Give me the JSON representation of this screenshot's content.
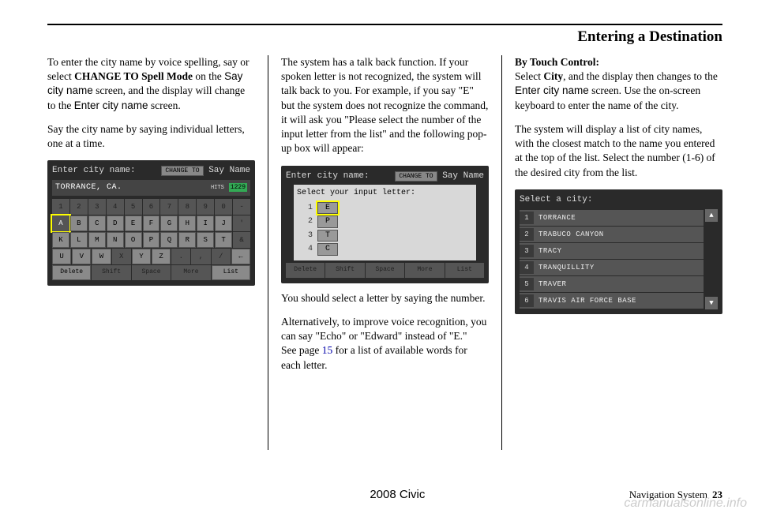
{
  "header": {
    "title": "Entering a Destination"
  },
  "col1": {
    "p1a": "To enter the city name by voice spelling, say or select ",
    "p1b": "CHANGE TO Spell Mode",
    "p1c": " on the ",
    "p1d": "Say city name",
    "p1e": " screen, and the display will change to the ",
    "p1f": "Enter city name",
    "p1g": " screen.",
    "p2": "Say the city name by saying individual letters, one at a time.",
    "ss": {
      "title": "Enter city name:",
      "change_btn": "CHANGE TO",
      "say": "Say Name",
      "input": "TORRANCE, CA.",
      "hits_label": "HITS",
      "hits": "1229",
      "row_nums": [
        "1",
        "2",
        "3",
        "4",
        "5",
        "6",
        "7",
        "8",
        "9",
        "0",
        "-"
      ],
      "row_a": [
        "A",
        "B",
        "C",
        "D",
        "E",
        "F",
        "G",
        "H",
        "I",
        "J",
        "'"
      ],
      "row_k": [
        "K",
        "L",
        "M",
        "N",
        "O",
        "P",
        "Q",
        "R",
        "S",
        "T",
        "&"
      ],
      "row_u": [
        "U",
        "V",
        "W",
        "X",
        "Y",
        "Z",
        ".",
        ",",
        "/",
        "←"
      ],
      "bottom": [
        "Delete",
        "Shift",
        "Space",
        "More",
        "List"
      ]
    }
  },
  "col2": {
    "p1": "The system has a talk back function. If your spoken letter is not recognized, the system will talk back to you. For example, if you say \"E\" but the system does not recognize the command, it will ask you \"Please select the number of the input letter from the list\" and the following pop-up box will appear:",
    "ss": {
      "title_bg": "Enter city name:",
      "change_btn": "CHANGE TO",
      "say": "Say Name",
      "popup_title": "Select your input letter:",
      "options": [
        {
          "n": "1",
          "v": "E"
        },
        {
          "n": "2",
          "v": "P"
        },
        {
          "n": "3",
          "v": "T"
        },
        {
          "n": "4",
          "v": "C"
        }
      ],
      "bottom": [
        "Delete",
        "Shift",
        "Space",
        "More",
        "List"
      ]
    },
    "p2": "You should select a letter by saying the number.",
    "p3a": "Alternatively, to improve voice recognition, you can say \"Echo\" or \"Edward\" instead of \"E.\"",
    "p3b": "See page ",
    "p3_link": "15",
    "p3c": " for a list of available words for each letter."
  },
  "col3": {
    "h": "By Touch Control:",
    "p1a": "Select ",
    "p1b": "City",
    "p1c": ", and the display then changes to the ",
    "p1d": "Enter city name",
    "p1e": " screen. Use the on-screen keyboard to enter the name of the city.",
    "p2": "The system will display a list of city names, with the closest match to the name you entered at the top of the list. Select the number (1-6) of the desired city from the list.",
    "ss": {
      "title": "Select a city:",
      "items": [
        {
          "n": "1",
          "v": "TORRANCE"
        },
        {
          "n": "2",
          "v": "TRABUCO CANYON"
        },
        {
          "n": "3",
          "v": "TRACY"
        },
        {
          "n": "4",
          "v": "TRANQUILLITY"
        },
        {
          "n": "5",
          "v": "TRAVER"
        },
        {
          "n": "6",
          "v": "TRAVIS AIR FORCE BASE"
        }
      ],
      "up": "▲",
      "down": "▼"
    }
  },
  "footer": {
    "model": "2008   Civic",
    "navsys": "Navigation System",
    "page": "23",
    "watermark": "carmanualsonline.info"
  }
}
